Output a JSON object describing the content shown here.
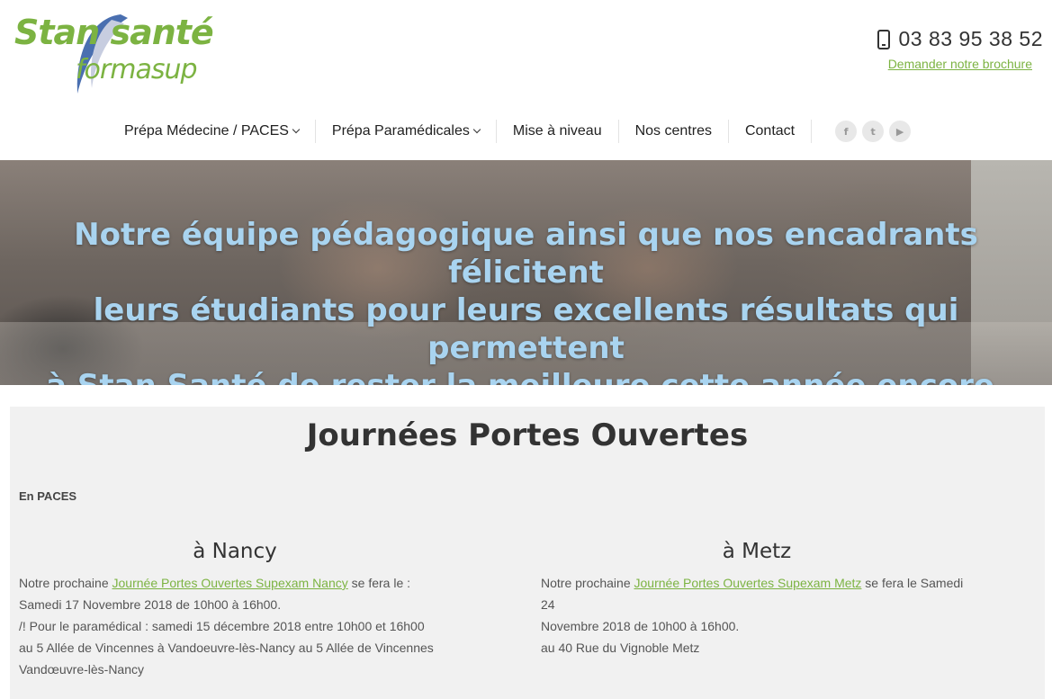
{
  "logo": {
    "line1": "Stan santé",
    "line2": "formasup"
  },
  "header": {
    "phone": "03 83 95 38 52",
    "brochure": "Demander notre brochure"
  },
  "nav": {
    "items": [
      {
        "label": "Prépa Médecine / PACES",
        "dropdown": true
      },
      {
        "label": "Prépa Paramédicales",
        "dropdown": true
      },
      {
        "label": "Mise à niveau",
        "dropdown": false
      },
      {
        "label": "Nos centres",
        "dropdown": false
      },
      {
        "label": "Contact",
        "dropdown": false
      }
    ],
    "socials": {
      "facebook": "f",
      "twitter": "t",
      "youtube": "▶"
    }
  },
  "hero": {
    "line1": "Notre équipe pédagogique ainsi que nos encadrants félicitent",
    "line2": "leurs étudiants pour leurs excellents résultats qui permettent",
    "line3": "à Stan Santé de rester la meilleure cette année encore."
  },
  "open_days": {
    "title": "Journées Portes Ouvertes",
    "subtitle": "En PACES",
    "nancy": {
      "title": "à Nancy",
      "prefix": "Notre prochaine ",
      "link": "Journée Portes Ouvertes Supexam Nancy",
      "suffix": " se fera le :",
      "date": "Samedi 17 Novembre 2018 de 10h00 à 16h00.",
      "para": "/! Pour le paramédical : samedi 15 décembre 2018 entre 10h00 et 16h00",
      "address1": "au 5 Allée de Vincennes à  Vandoeuvre-lès-Nancy au 5 Allée de Vincennes",
      "address2": "Vandœuvre-lès-Nancy"
    },
    "metz": {
      "title": "à Metz",
      "prefix": "Notre prochaine ",
      "link": "Journée Portes Ouvertes Supexam Metz",
      "suffix": " se fera le Samedi 24",
      "date": "Novembre 2018 de 10h00 à 16h00.",
      "address": "au 40 Rue du Vignoble Metz"
    }
  },
  "colors": {
    "accent": "#7cb342",
    "hero_text": "#a9d4f0",
    "logo_swoosh": "#4a6fb0"
  }
}
